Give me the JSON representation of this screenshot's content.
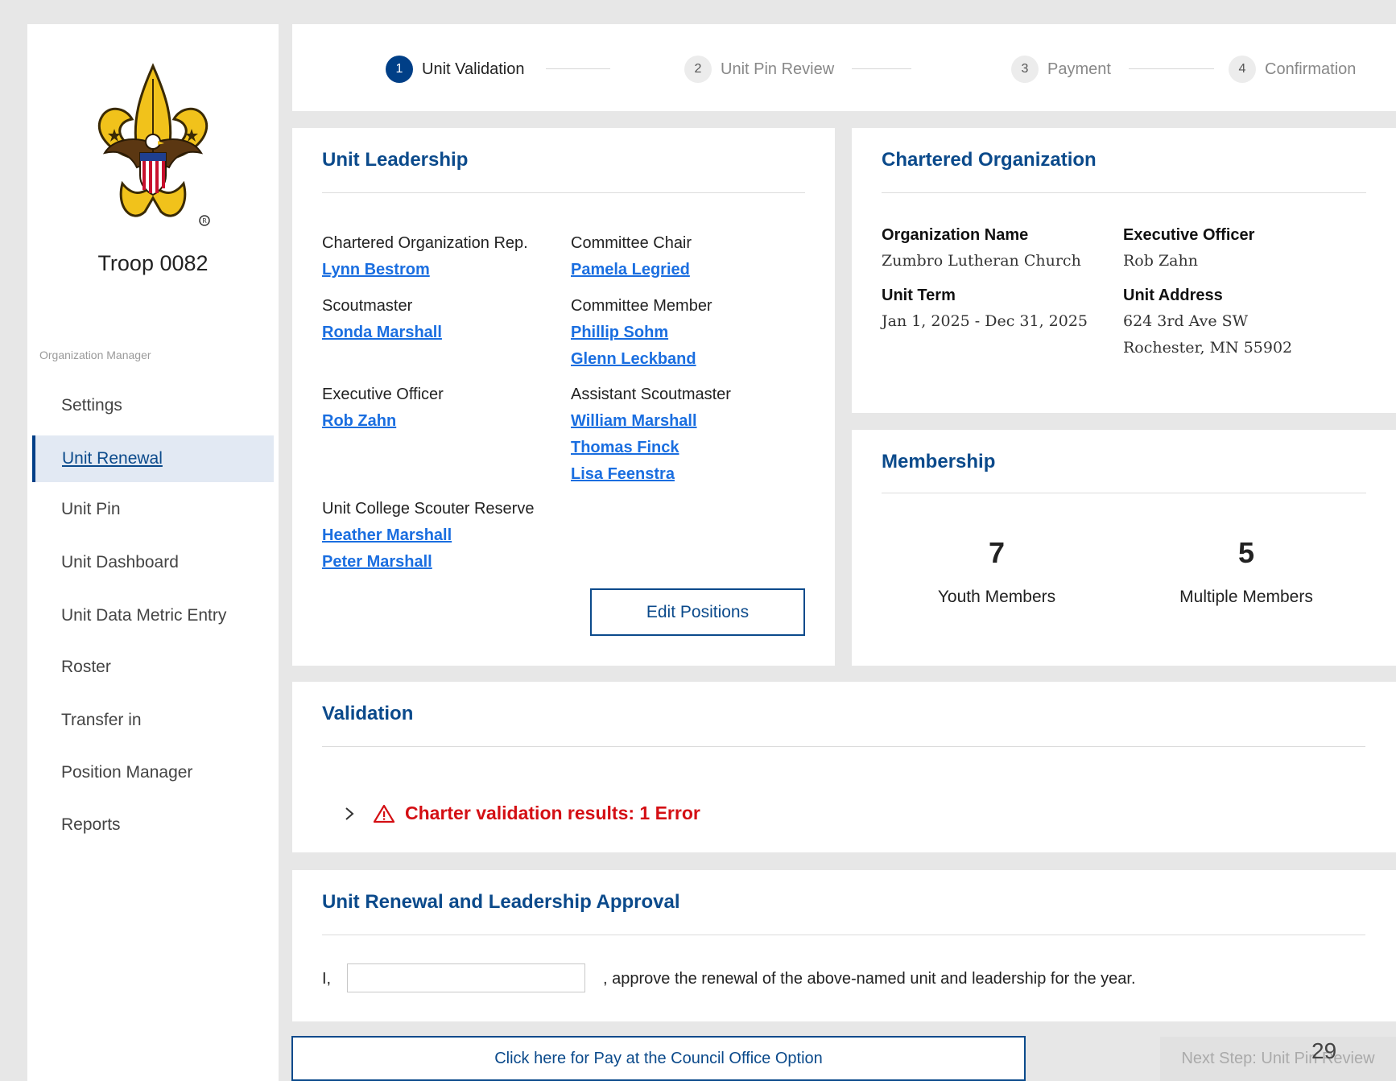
{
  "sidebar": {
    "troop_name": "Troop 0082",
    "section_label": "Organization Manager",
    "items": [
      {
        "label": "Settings"
      },
      {
        "label": "Unit Renewal"
      },
      {
        "label": "Unit Pin"
      },
      {
        "label": "Unit Dashboard"
      },
      {
        "label": "Unit Data Metric Entry"
      },
      {
        "label": "Roster"
      },
      {
        "label": "Transfer in"
      },
      {
        "label": "Position Manager"
      },
      {
        "label": "Reports"
      }
    ],
    "active_item": "Unit Renewal"
  },
  "stepper": {
    "steps": [
      {
        "num": "1",
        "label": "Unit Validation"
      },
      {
        "num": "2",
        "label": "Unit Pin Review"
      },
      {
        "num": "3",
        "label": "Payment"
      },
      {
        "num": "4",
        "label": "Confirmation"
      }
    ],
    "active_step": "1"
  },
  "leadership": {
    "title": "Unit Leadership",
    "chartered_org_rep": {
      "label": "Chartered Organization Rep.",
      "people": [
        "Lynn Bestrom"
      ]
    },
    "committee_chair": {
      "label": "Committee Chair",
      "people": [
        "Pamela Legried"
      ]
    },
    "scoutmaster": {
      "label": "Scoutmaster",
      "people": [
        "Ronda Marshall"
      ]
    },
    "committee_member": {
      "label": "Committee Member",
      "people": [
        "Phillip Sohm",
        "Glenn Leckband"
      ]
    },
    "executive_officer": {
      "label": "Executive Officer",
      "people": [
        "Rob Zahn"
      ]
    },
    "assistant_scoutmaster": {
      "label": "Assistant Scoutmaster",
      "people": [
        "William Marshall",
        "Thomas Finck",
        "Lisa Feenstra"
      ]
    },
    "college_reserve": {
      "label": "Unit College Scouter Reserve",
      "people": [
        "Heather Marshall",
        "Peter Marshall"
      ]
    },
    "edit_button": "Edit Positions"
  },
  "chartered_org": {
    "title": "Chartered Organization",
    "org_name_label": "Organization Name",
    "org_name": "Zumbro Lutheran Church",
    "exec_officer_label": "Executive Officer",
    "exec_officer": "Rob Zahn",
    "unit_term_label": "Unit Term",
    "unit_term": "Jan 1, 2025 - Dec 31, 2025",
    "unit_address_label": "Unit Address",
    "unit_address_line1": "624 3rd Ave SW",
    "unit_address_line2": "Rochester, MN 55902"
  },
  "membership": {
    "title": "Membership",
    "youth_count": "7",
    "youth_label": "Youth Members",
    "multiple_count": "5",
    "multiple_label": "Multiple Members"
  },
  "validation": {
    "title": "Validation",
    "result_text": "Charter validation results: 1 Error"
  },
  "approval": {
    "title": "Unit Renewal and Leadership Approval",
    "prefix": "I,",
    "input_value": "",
    "suffix": ", approve the renewal of the above-named unit and leadership for the year."
  },
  "actions": {
    "pay_council": "Click here for Pay at the Council Office Option",
    "next_step": "Next Step: Unit Pin Review"
  },
  "page_number": "29",
  "colors": {
    "brand_blue": "#0b4a8b",
    "link_blue": "#1a6ee0",
    "error_red": "#d40f14",
    "background": "#e7e7e7"
  }
}
